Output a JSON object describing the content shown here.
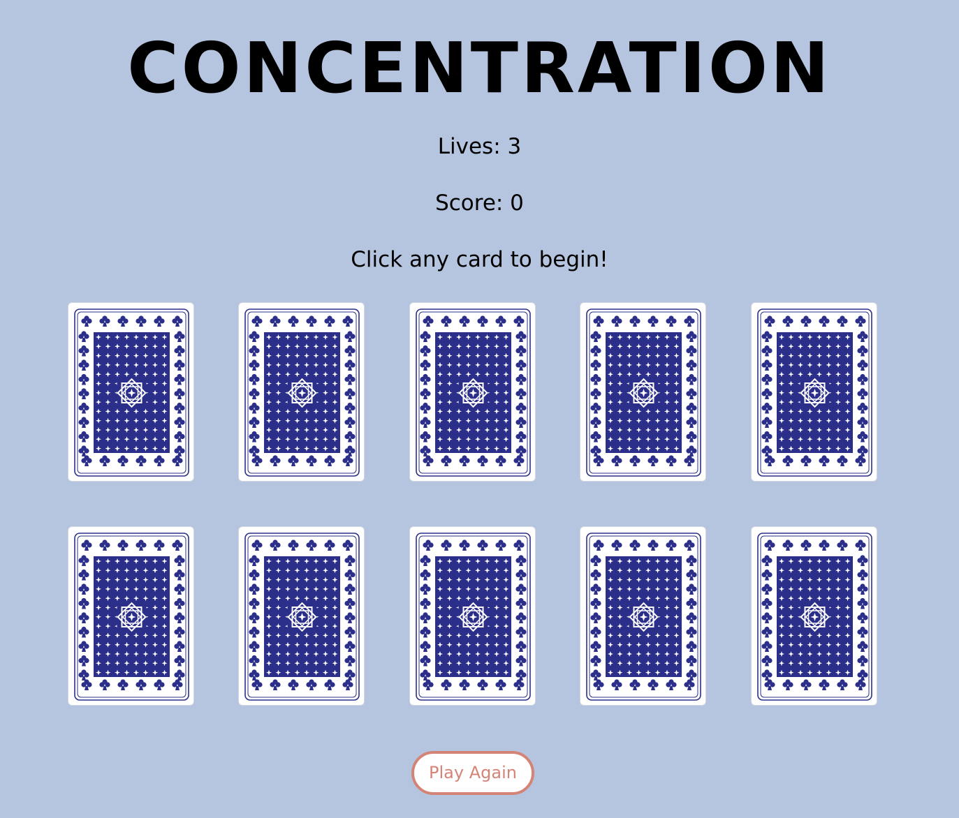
{
  "header": {
    "title": "CONCENTRATION"
  },
  "status": {
    "lives": "Lives: 3",
    "score": "Score: 0",
    "message": "Click any card to begin!"
  },
  "cards": [
    {
      "face": "down"
    },
    {
      "face": "down"
    },
    {
      "face": "down"
    },
    {
      "face": "down"
    },
    {
      "face": "down"
    },
    {
      "face": "down"
    },
    {
      "face": "down"
    },
    {
      "face": "down"
    },
    {
      "face": "down"
    },
    {
      "face": "down"
    }
  ],
  "controls": {
    "play_again_label": "Play Again"
  },
  "colors": {
    "background": "#b5c5df",
    "card_back": "#2b2f8a",
    "card_face": "#ffffff",
    "button_accent": "#d48477"
  },
  "icons": {
    "card_back_pattern": "card-back-icon"
  }
}
